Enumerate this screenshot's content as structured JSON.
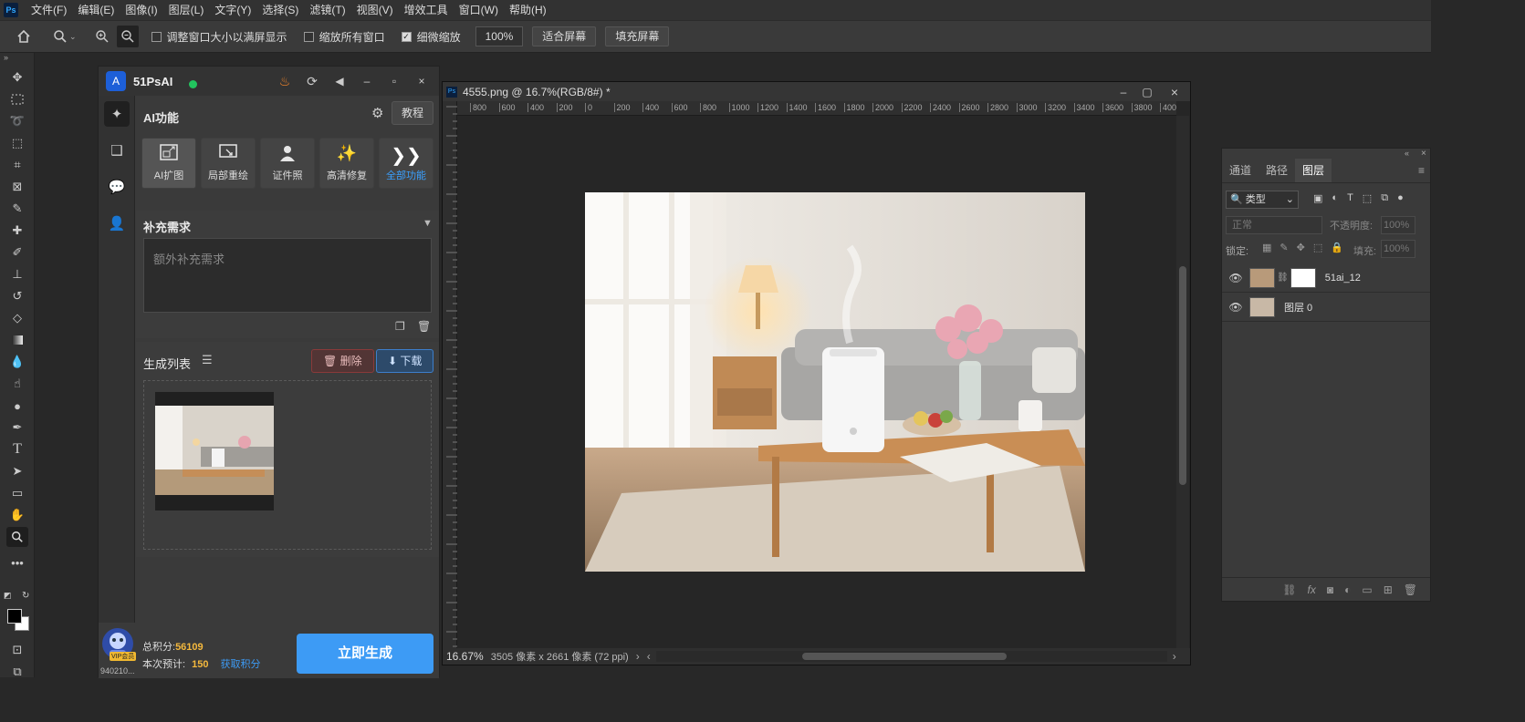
{
  "menubar": {
    "logo": "Ps",
    "items": [
      "文件(F)",
      "编辑(E)",
      "图像(I)",
      "图层(L)",
      "文字(Y)",
      "选择(S)",
      "滤镜(T)",
      "视图(V)",
      "增效工具",
      "窗口(W)",
      "帮助(H)"
    ]
  },
  "options": {
    "resize_windows_label": "调整窗口大小以满屏显示",
    "resize_windows_checked": false,
    "zoom_all_label": "缩放所有窗口",
    "zoom_all_checked": false,
    "scrubby_zoom_label": "细微缩放",
    "scrubby_zoom_checked": true,
    "zoom_value": "100%",
    "fit_screen_label": "适合屏幕",
    "fill_screen_label": "填充屏幕"
  },
  "plugin": {
    "title": "51PsAI",
    "ai_section_title": "AI功能",
    "tutorial_label": "教程",
    "functions": [
      {
        "label": "AI扩图",
        "icon": "expand-icon"
      },
      {
        "label": "局部重绘",
        "icon": "repaint-icon"
      },
      {
        "label": "证件照",
        "icon": "id-photo-icon"
      },
      {
        "label": "高清修复",
        "icon": "sparkle-icon"
      },
      {
        "label": "全部功能",
        "icon": "double-chevron-icon"
      }
    ],
    "supplement_title": "补充需求",
    "supplement_placeholder": "额外补充需求",
    "gen_list_title": "生成列表",
    "delete_label": "删除",
    "download_label": "下载",
    "user_id": "940210...",
    "vip_badge": "VIP会员",
    "total_points_label": "总积分:",
    "total_points": "56109",
    "estimate_label": "本次预计:",
    "estimate_value": "150",
    "get_points_label": "获取积分",
    "generate_label": "立即生成",
    "colors": {
      "accent": "#3d9bf5",
      "points": "#f5b93d",
      "online": "#22c55e"
    }
  },
  "document": {
    "title": "4555.png @ 16.7%(RGB/8#) *",
    "ruler_h_ticks": [
      "800",
      "600",
      "400",
      "200",
      "0",
      "200",
      "400",
      "600",
      "800",
      "1000",
      "1200",
      "1400",
      "1600",
      "1800",
      "2000",
      "2200",
      "2400",
      "2600",
      "2800",
      "3000",
      "3200",
      "3400",
      "3600",
      "3800",
      "4000"
    ],
    "zoom": "16.67%",
    "info": "3505 像素 x 2661 像素 (72 ppi)"
  },
  "layers_panel": {
    "tabs": [
      "通道",
      "路径",
      "图层"
    ],
    "active_tab": "图层",
    "filter_label": "类型",
    "blend_mode": "正常",
    "opacity_label": "不透明度:",
    "opacity_value": "100%",
    "lock_label": "锁定:",
    "fill_label": "填充:",
    "fill_value": "100%",
    "layers": [
      {
        "name": "51ai_12",
        "visible": true,
        "has_mask": true
      },
      {
        "name": "图层 0",
        "visible": true,
        "has_mask": false
      }
    ]
  }
}
